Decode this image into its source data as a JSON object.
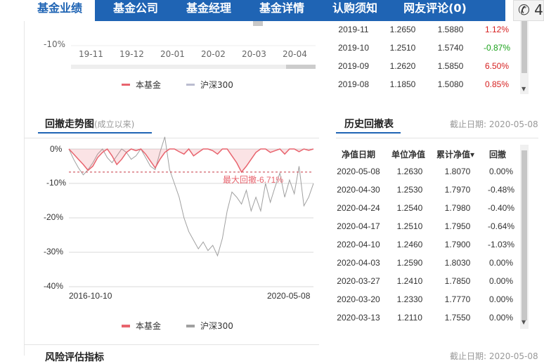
{
  "nav": {
    "tabs": [
      "基金业绩",
      "基金公司",
      "基金经理",
      "基金详情",
      "认购须知",
      "网友评论(0)"
    ],
    "phone_text": "4"
  },
  "top_chart": {
    "y_label": "-10%",
    "x_ticks": [
      "19-11",
      "19-12",
      "20-01",
      "20-02",
      "20-03",
      "20-04"
    ],
    "legend": [
      "本基金",
      "沪深300"
    ]
  },
  "top_table": {
    "rows": [
      [
        "2019-11",
        "1.2650",
        "1.5880",
        "1.12%"
      ],
      [
        "2019-10",
        "1.2510",
        "1.5740",
        "-0.87%"
      ],
      [
        "2019-09",
        "1.2620",
        "1.5850",
        "6.50%"
      ],
      [
        "2019-08",
        "1.1850",
        "1.5080",
        "0.85%"
      ]
    ]
  },
  "drawdown": {
    "title": "回撤走势图",
    "subtitle": "(成立以来)",
    "max_label": "最大回撤-6.71%",
    "legend": [
      "本基金",
      "沪深300"
    ]
  },
  "history": {
    "title": "历史回撤表",
    "date_note": "截止日期:  2020-05-08",
    "headers": [
      "净值日期",
      "单位净值",
      "累计净值▾",
      "回撤"
    ],
    "rows": [
      [
        "2020-05-08",
        "1.2630",
        "1.8070",
        "0.00%"
      ],
      [
        "2020-04-30",
        "1.2530",
        "1.7970",
        "-0.48%"
      ],
      [
        "2020-04-24",
        "1.2540",
        "1.7980",
        "-0.40%"
      ],
      [
        "2020-04-17",
        "1.2510",
        "1.7950",
        "-0.64%"
      ],
      [
        "2020-04-10",
        "1.2460",
        "1.7900",
        "-1.03%"
      ],
      [
        "2020-04-03",
        "1.2590",
        "1.8030",
        "0.00%"
      ],
      [
        "2020-03-27",
        "1.2410",
        "1.7850",
        "0.00%"
      ],
      [
        "2020-03-20",
        "1.2330",
        "1.7770",
        "0.00%"
      ],
      [
        "2020-03-13",
        "1.2110",
        "1.7550",
        "0.00%"
      ]
    ]
  },
  "bottom": {
    "title": "风险评估指标",
    "date_note": "截止日期:  2020-05-08"
  },
  "colors": {
    "brand": "#1f64b4",
    "fund_line": "#e8646e",
    "index_line": "#a0a0a0",
    "positive": "#d62020",
    "negative": "#19a119"
  },
  "chart_data": {
    "type": "area",
    "title": "回撤走势图",
    "ylim": [
      -40,
      0
    ],
    "yticks": [
      "0%",
      "-10%",
      "-20%",
      "-30%",
      "-40%"
    ],
    "x_ticks": [
      "2016-10-10",
      "2020-05-08"
    ],
    "series": [
      {
        "name": "本基金",
        "values": [
          0,
          -1.5,
          -3,
          -4.5,
          -6.2,
          -5,
          -2.5,
          -1,
          0,
          -2,
          -4.5,
          -3,
          -1,
          0,
          -0.5,
          0,
          -1.5,
          -3.5,
          -5.5,
          -3,
          -1,
          0,
          0,
          -0.8,
          -1.5,
          0,
          -2,
          -1,
          0,
          0,
          -0.5,
          -1.5,
          0,
          0,
          -2,
          -4,
          -6.71,
          -5,
          -3,
          -1,
          0,
          0,
          -1,
          -0.5,
          0,
          -1.5,
          0,
          0,
          -0.8,
          0,
          -0.4,
          0
        ]
      },
      {
        "name": "沪深300",
        "values": [
          0,
          -3,
          -5.5,
          -7.5,
          -6,
          -4,
          -1.5,
          0,
          -2.5,
          -4,
          -2,
          0,
          -1,
          -3,
          -2,
          0,
          -2.5,
          -5,
          -6,
          -1,
          3.5,
          -6,
          -10,
          -14,
          -20,
          -24,
          -26.5,
          -29,
          -27,
          -29.5,
          -28,
          -31,
          -26,
          -18,
          -12.5,
          -14,
          -16,
          -12,
          -18,
          -14,
          -18,
          -10,
          -15.5,
          -11,
          -7,
          -14,
          -9,
          -13,
          -5,
          -16.5,
          -14,
          -10
        ]
      }
    ],
    "max_drawdown": -6.71
  }
}
